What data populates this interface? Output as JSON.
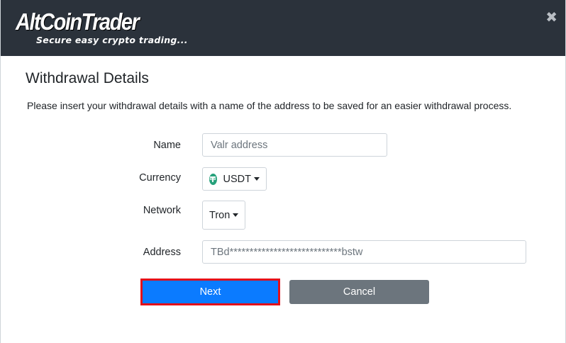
{
  "header": {
    "logo": "AltCoinTrader",
    "tagline": "Secure easy crypto trading...",
    "close_icon": "close-icon"
  },
  "dialog": {
    "title": "Withdrawal Details",
    "description": "Please insert your withdrawal details with a name of the address to be saved for an easier withdrawal process."
  },
  "form": {
    "name": {
      "label": "Name",
      "value": "Valr address"
    },
    "currency": {
      "label": "Currency",
      "selected": "USDT",
      "icon": "usdt-icon",
      "icon_color": "#26a17b"
    },
    "network": {
      "label": "Network",
      "selected": "Tron"
    },
    "address": {
      "label": "Address",
      "value": "TBd****************************bstw"
    }
  },
  "actions": {
    "next_label": "Next",
    "cancel_label": "Cancel",
    "next_color": "#0b7bff",
    "next_highlight": "#e3101b",
    "cancel_color": "#6c757d"
  }
}
